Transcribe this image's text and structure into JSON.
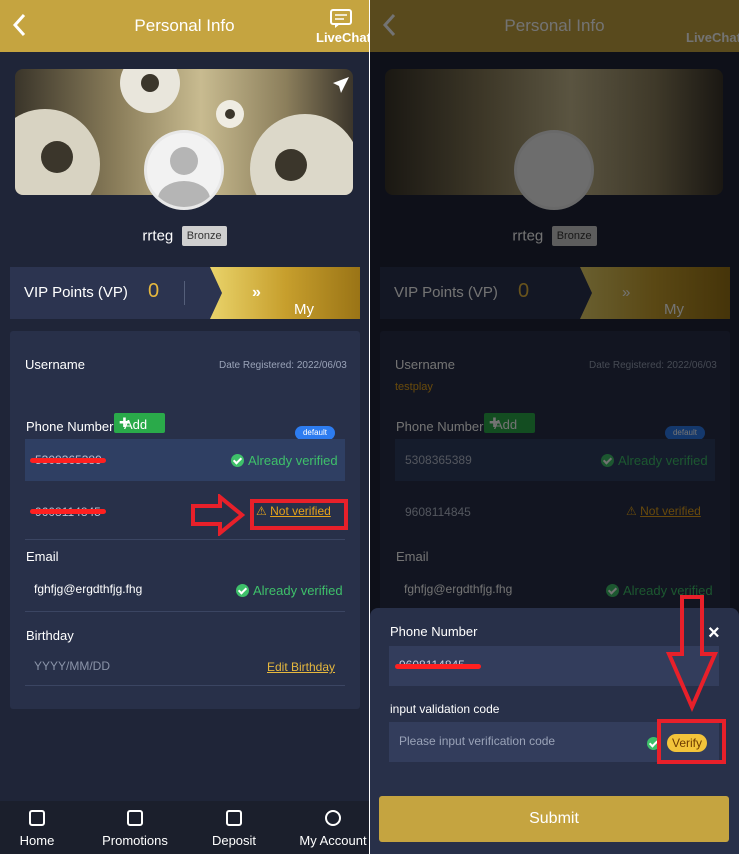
{
  "header": {
    "title": "Personal Info",
    "livechat": "LiveChat"
  },
  "profile": {
    "username": "rrteg",
    "level": "Bronze"
  },
  "vip": {
    "label": "VIP Points (VP)",
    "value": "0",
    "button": "My Vip"
  },
  "info": {
    "username_label": "Username",
    "date_registered": "Date Registered: 2022/06/03",
    "username_value": "testplay",
    "phone_label": "Phone Number",
    "add_label": "Add",
    "default_tag": "default",
    "phone1": "5308365389",
    "phone1_status": "Already verified",
    "phone2": "9608114845",
    "phone2_status": "Not verified",
    "email_label": "Email",
    "email_value": "fghfjg@ergdthfjg.fhg",
    "email_status": "Already verified",
    "birthday_label": "Birthday",
    "birthday_placeholder": "YYYY/MM/DD",
    "edit_birthday": "Edit Birthday"
  },
  "tabs": [
    {
      "label": "Home"
    },
    {
      "label": "Promotions"
    },
    {
      "label": "Deposit"
    },
    {
      "label": "My Account"
    }
  ],
  "modal": {
    "phone_label": "Phone Number",
    "phone_value": "9608114845",
    "code_label": "input validation code",
    "code_placeholder": "Please input verification code",
    "verify_label": "Verify",
    "submit_label": "Submit",
    "close_icon": "×"
  },
  "colors": {
    "gold": "#c5a440",
    "bg": "#1f2538",
    "card": "#283049",
    "ok_green": "#3ec06a",
    "warn": "#e6a31b",
    "annotation_red": "#e8202a"
  }
}
